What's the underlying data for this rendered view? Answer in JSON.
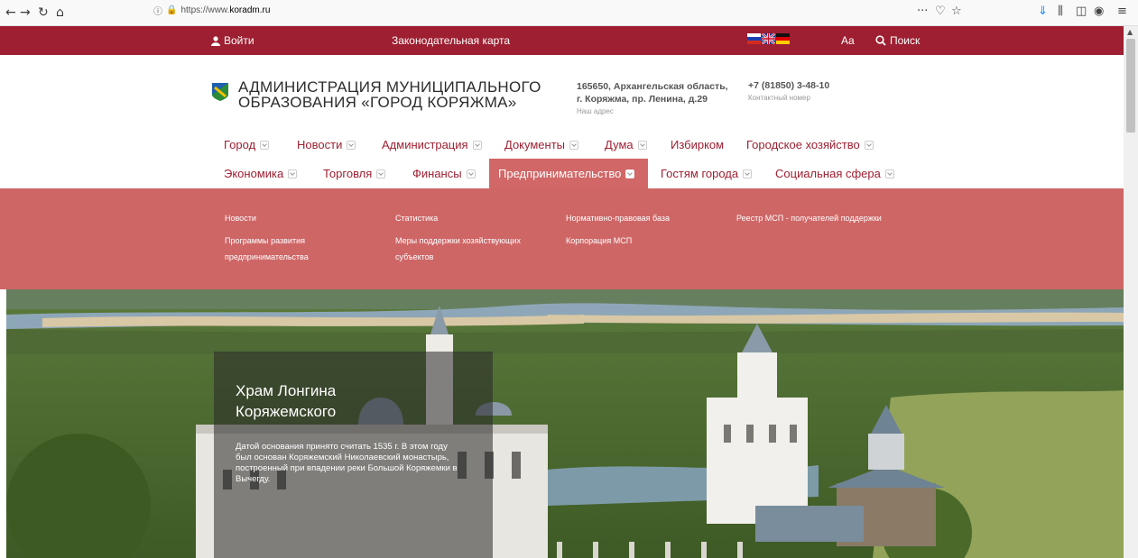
{
  "browser": {
    "url_prefix": "https://www.",
    "url_host": "koradm.ru",
    "back": "←",
    "forward": "→",
    "reload": "↻",
    "home": "⌂",
    "menu_dots": "···"
  },
  "topbar": {
    "login": "Войти",
    "map": "Законодательная карта",
    "font_size": "Aa",
    "search": "Поиск",
    "flags": [
      "ru-flag",
      "uk-flag",
      "de-flag"
    ]
  },
  "header": {
    "title_line1": "АДМИНИСТРАЦИЯ МУНИЦИПАЛЬНОГО",
    "title_line2": "ОБРАЗОВАНИЯ «ГОРОД КОРЯЖМА»",
    "address_line1": "165650, Архангельская область,",
    "address_line2": "г. Коряжма, пр. Ленина, д.29",
    "address_label": "Наш адрес",
    "phone": "+7 (81850) 3-48-10",
    "phone_label": "Контактный номер"
  },
  "menu_row1": [
    "Город",
    "Новости",
    "Администрация",
    "Документы",
    "Дума",
    "Избирком",
    "Городское хозяйство"
  ],
  "menu_row2": [
    "Экономика",
    "Торговля",
    "Финансы",
    "Предпринимательство",
    "Гостям города",
    "Социальная сфера"
  ],
  "dropdown": {
    "col1_a": "Новости",
    "col1_b1": "Программы развития",
    "col1_b2": "предпринимательства",
    "col2_a": "Статистика",
    "col2_b1": "Меры поддержки хозяйствующих",
    "col2_b2": "субъектов",
    "col3_a": "Нормативно-правовая база",
    "col3_b": "Корпорация МСП",
    "col4_a": "Реестр МСП - получателей поддержки"
  },
  "hero": {
    "title_line1": "Храм Лонгина",
    "title_line2": "Коряжемского",
    "description": "Датой основания принято считать 1535 г. В этом году был основан Коряжемский Николаевский монастырь, построенный при впадении реки Большой Коряжемки в Вычегду."
  },
  "colors": {
    "brand": "#9e1f31",
    "dropdown": "#cf6666"
  }
}
